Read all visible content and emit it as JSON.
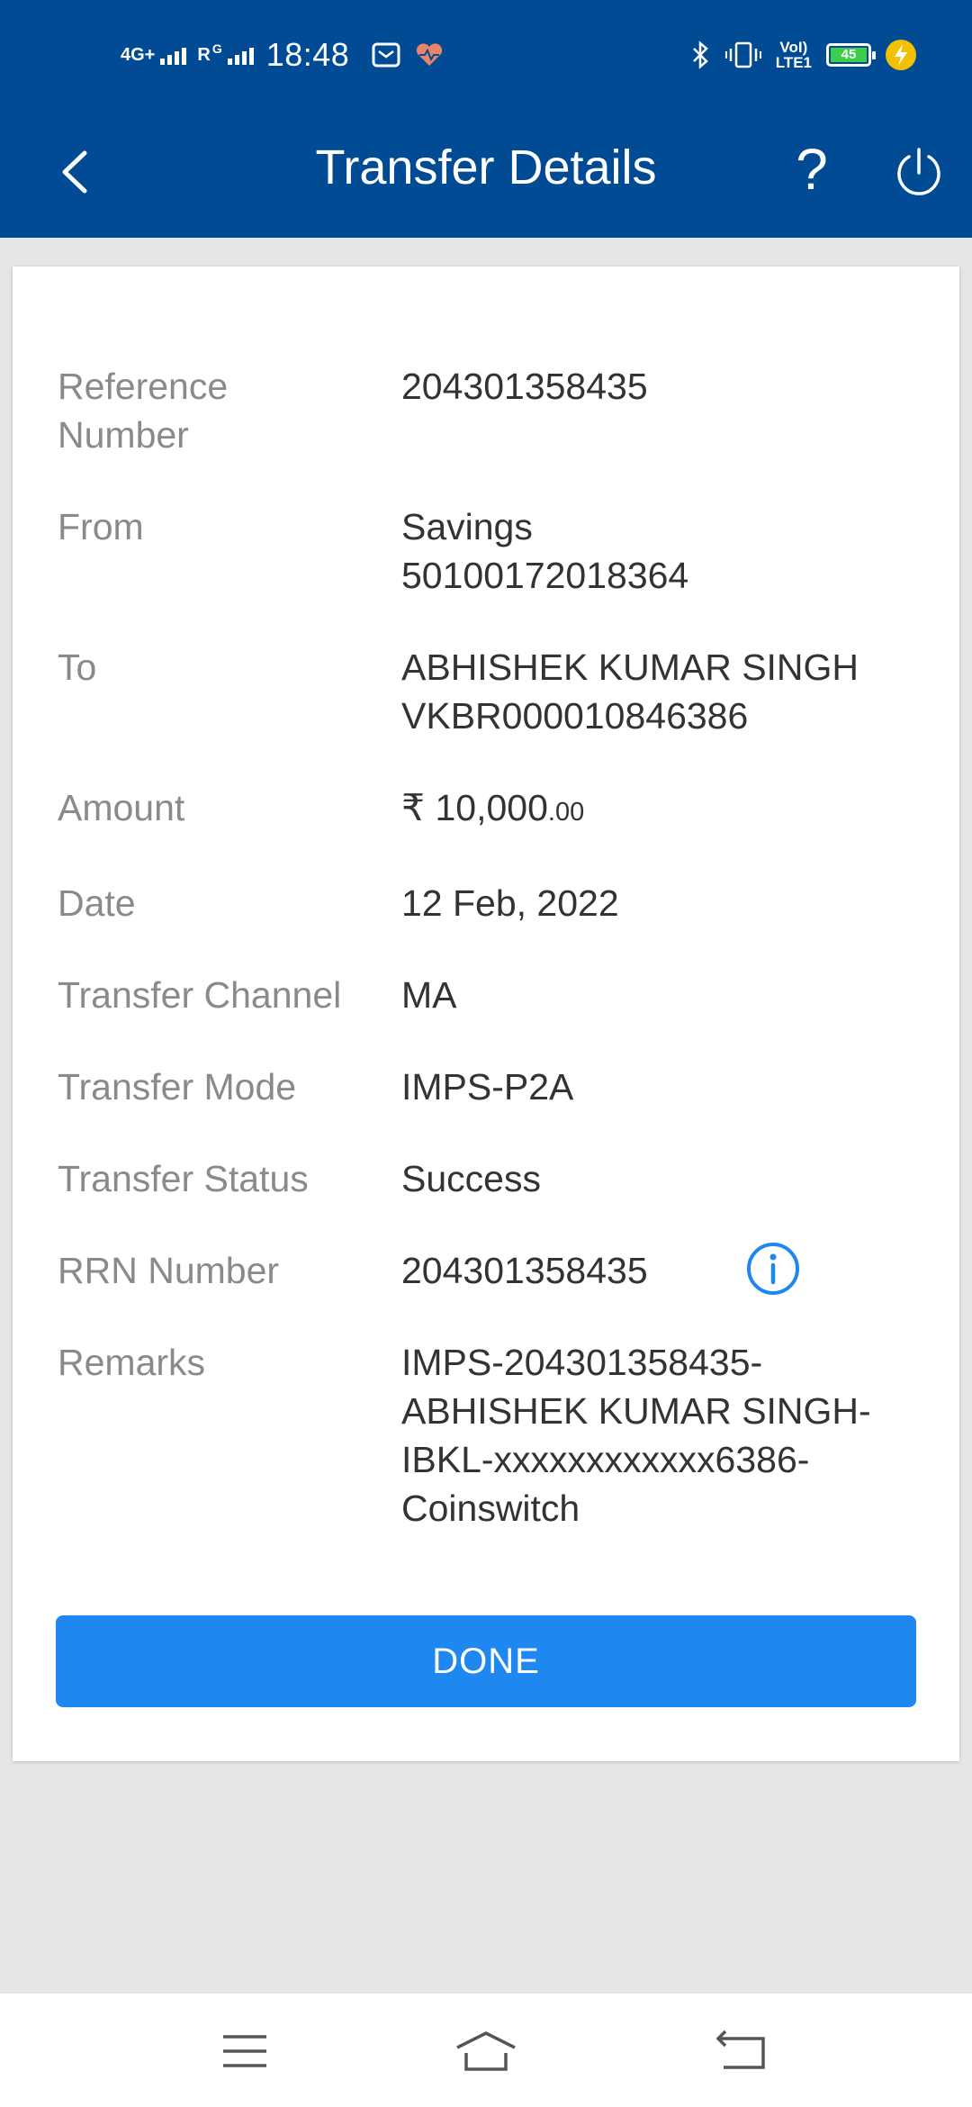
{
  "status_bar": {
    "network_1": "4G+",
    "network_2": "R",
    "network_2_sup": "G",
    "time": "18:48",
    "volte_line1": "VoI)",
    "volte_line2": "LTE1",
    "battery_level": "45",
    "app_icon": "email-icon",
    "health_icon": "heart-icon",
    "bluetooth_icon": "bluetooth-icon",
    "vibrate_icon": "vibrate-icon",
    "charging_icon": "lightning-icon"
  },
  "toolbar": {
    "title": "Transfer Details",
    "help_label": "?",
    "back_icon": "chevron-left-icon",
    "logout_icon": "power-icon"
  },
  "details": {
    "reference_number": {
      "label": "Reference Number",
      "value": "204301358435"
    },
    "from": {
      "label": "From",
      "line1": "Savings",
      "line2": "50100172018364"
    },
    "to": {
      "label": "To",
      "line1": "ABHISHEK KUMAR SINGH",
      "line2": "VKBR000010846386"
    },
    "amount": {
      "label": "Amount",
      "currency": "₹",
      "whole": "10,000",
      "paise": ".00"
    },
    "date": {
      "label": "Date",
      "value": "12 Feb, 2022"
    },
    "transfer_channel": {
      "label": "Transfer Channel",
      "value": "MA"
    },
    "transfer_mode": {
      "label": "Transfer Mode",
      "value": "IMPS-P2A"
    },
    "transfer_status": {
      "label": "Transfer Status",
      "value": "Success"
    },
    "rrn_number": {
      "label": "RRN Number",
      "value": "204301358435"
    },
    "remarks": {
      "label": "Remarks",
      "lines": [
        "IMPS-204301358435-",
        "ABHISHEK KUMAR SINGH-",
        "IBKL-xxxxxxxxxxxx6386-",
        "Coinswitch"
      ]
    }
  },
  "done_button": "DONE",
  "nav_bar": {
    "menu_icon": "menu-icon",
    "home_icon": "home-icon",
    "back_icon": "back-arrow-icon"
  },
  "colors": {
    "header": "#004b93",
    "button": "#1e87f0",
    "label_text": "#8a8a8a",
    "value_text": "#333333",
    "background": "#e6e6e6"
  }
}
